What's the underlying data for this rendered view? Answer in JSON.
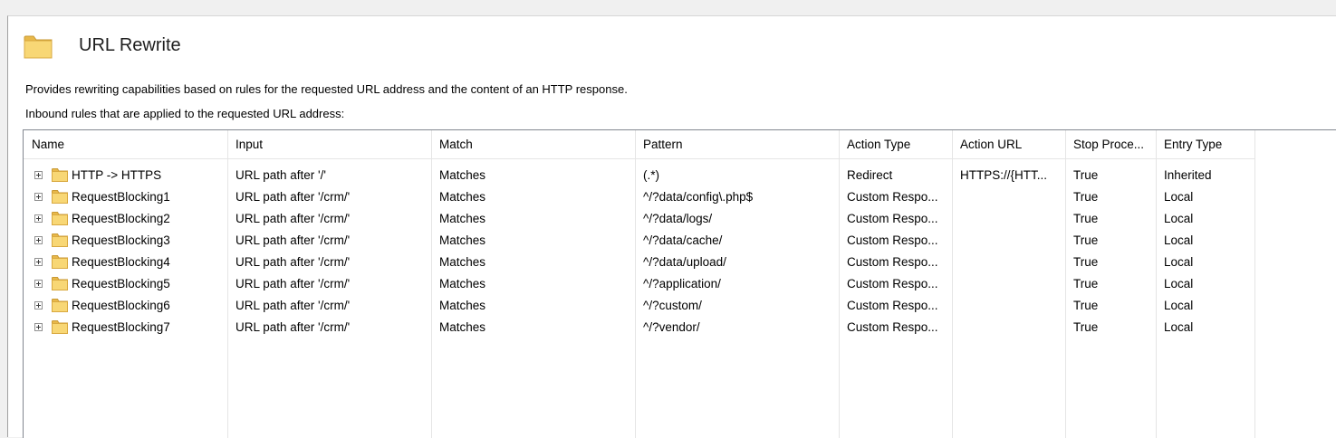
{
  "page": {
    "title": "URL Rewrite",
    "description": "Provides rewriting capabilities based on rules for the requested URL address and the content of an HTTP response.",
    "inbound_label": "Inbound rules that are applied to the requested URL address:"
  },
  "icons": {
    "header": "folder-icon",
    "row": "folder-icon",
    "expand": "plus-box-icon"
  },
  "colors": {
    "folder_light": "#f8d775",
    "folder_dark": "#e8b84a",
    "grid_border": "#828790"
  },
  "columns": [
    "Name",
    "Input",
    "Match",
    "Pattern",
    "Action Type",
    "Action URL",
    "Stop Proce...",
    "Entry Type"
  ],
  "rows": [
    {
      "name": "HTTP -> HTTPS",
      "input": "URL path after '/'",
      "match": "Matches",
      "pattern": "(.*)",
      "action_type": "Redirect",
      "action_url": "HTTPS://{HTT...",
      "stop": "True",
      "entry": "Inherited"
    },
    {
      "name": "RequestBlocking1",
      "input": "URL path after '/crm/'",
      "match": "Matches",
      "pattern": "^/?data/config\\.php$",
      "action_type": "Custom Respo...",
      "action_url": "",
      "stop": "True",
      "entry": "Local"
    },
    {
      "name": "RequestBlocking2",
      "input": "URL path after '/crm/'",
      "match": "Matches",
      "pattern": "^/?data/logs/",
      "action_type": "Custom Respo...",
      "action_url": "",
      "stop": "True",
      "entry": "Local"
    },
    {
      "name": "RequestBlocking3",
      "input": "URL path after '/crm/'",
      "match": "Matches",
      "pattern": "^/?data/cache/",
      "action_type": "Custom Respo...",
      "action_url": "",
      "stop": "True",
      "entry": "Local"
    },
    {
      "name": "RequestBlocking4",
      "input": "URL path after '/crm/'",
      "match": "Matches",
      "pattern": "^/?data/upload/",
      "action_type": "Custom Respo...",
      "action_url": "",
      "stop": "True",
      "entry": "Local"
    },
    {
      "name": "RequestBlocking5",
      "input": "URL path after '/crm/'",
      "match": "Matches",
      "pattern": "^/?application/",
      "action_type": "Custom Respo...",
      "action_url": "",
      "stop": "True",
      "entry": "Local"
    },
    {
      "name": "RequestBlocking6",
      "input": "URL path after '/crm/'",
      "match": "Matches",
      "pattern": "^/?custom/",
      "action_type": "Custom Respo...",
      "action_url": "",
      "stop": "True",
      "entry": "Local"
    },
    {
      "name": "RequestBlocking7",
      "input": "URL path after '/crm/'",
      "match": "Matches",
      "pattern": "^/?vendor/",
      "action_type": "Custom Respo...",
      "action_url": "",
      "stop": "True",
      "entry": "Local"
    }
  ]
}
